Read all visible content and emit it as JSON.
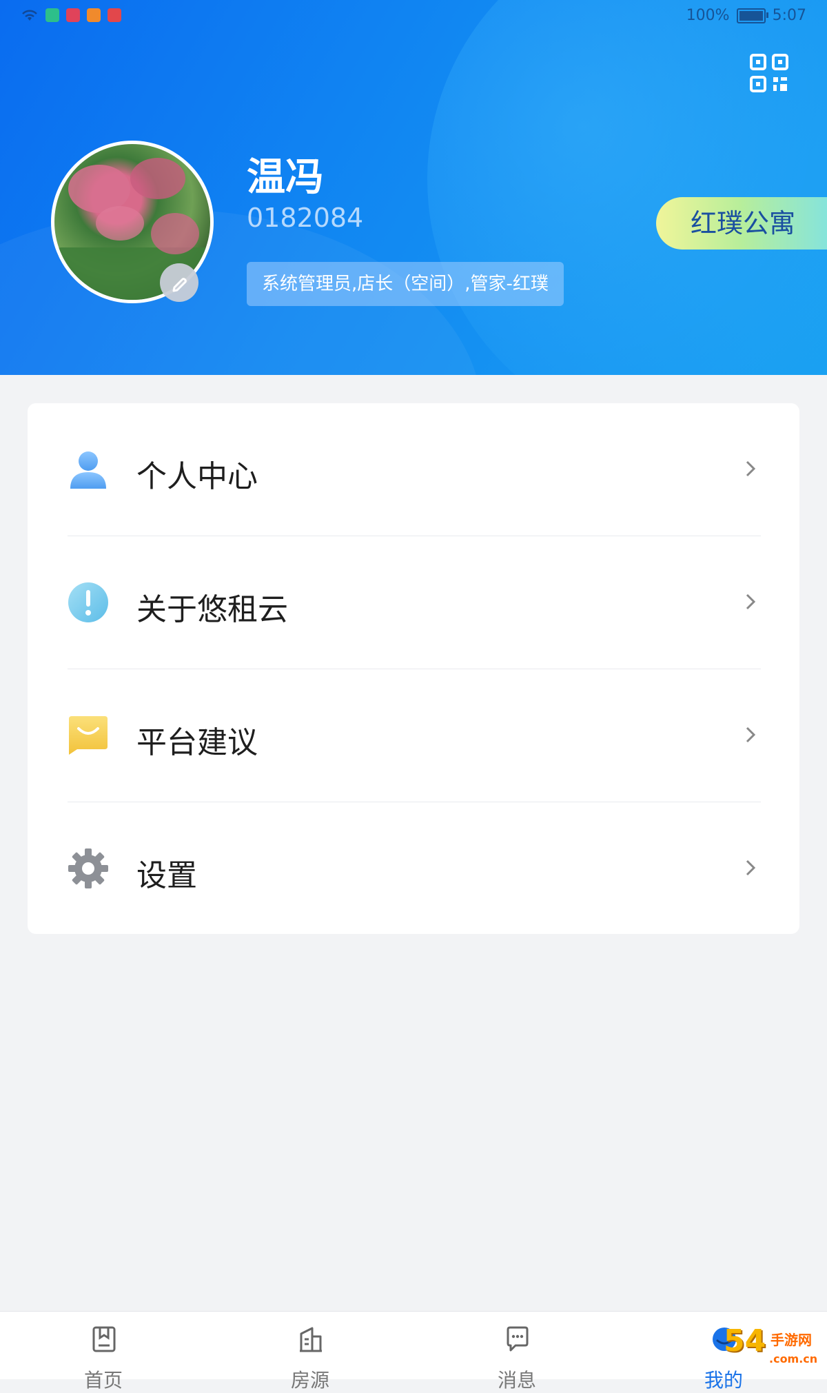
{
  "status_bar": {
    "battery_percent": "100%",
    "time": "5:07"
  },
  "header": {
    "user_name": "温冯",
    "user_id": "0182084",
    "role": "系统管理员,店长（空间）,管家-红璞",
    "apartment": "红璞公寓",
    "qr_icon": "qr-code-icon",
    "edit_icon": "pencil-icon"
  },
  "menu": {
    "items": [
      {
        "label": "个人中心",
        "icon": "person-icon",
        "color": "#5aa9f5"
      },
      {
        "label": "关于悠租云",
        "icon": "info-icon",
        "color": "#6cc7ee"
      },
      {
        "label": "平台建议",
        "icon": "suggestion-icon",
        "color": "#f5cf4a"
      },
      {
        "label": "设置",
        "icon": "gear-icon",
        "color": "#8a8d92"
      }
    ]
  },
  "bottom_nav": {
    "items": [
      {
        "label": "首页",
        "icon": "home-icon"
      },
      {
        "label": "房源",
        "icon": "building-icon"
      },
      {
        "label": "消息",
        "icon": "message-icon"
      },
      {
        "label": "我的",
        "icon": "profile-icon",
        "active": true
      }
    ]
  },
  "colors": {
    "primary": "#1187f2",
    "active_tab": "#1a73e8",
    "background": "#f2f3f5"
  },
  "watermark": {
    "number": "54",
    "text": "手游网",
    "domain": ".com.cn"
  }
}
